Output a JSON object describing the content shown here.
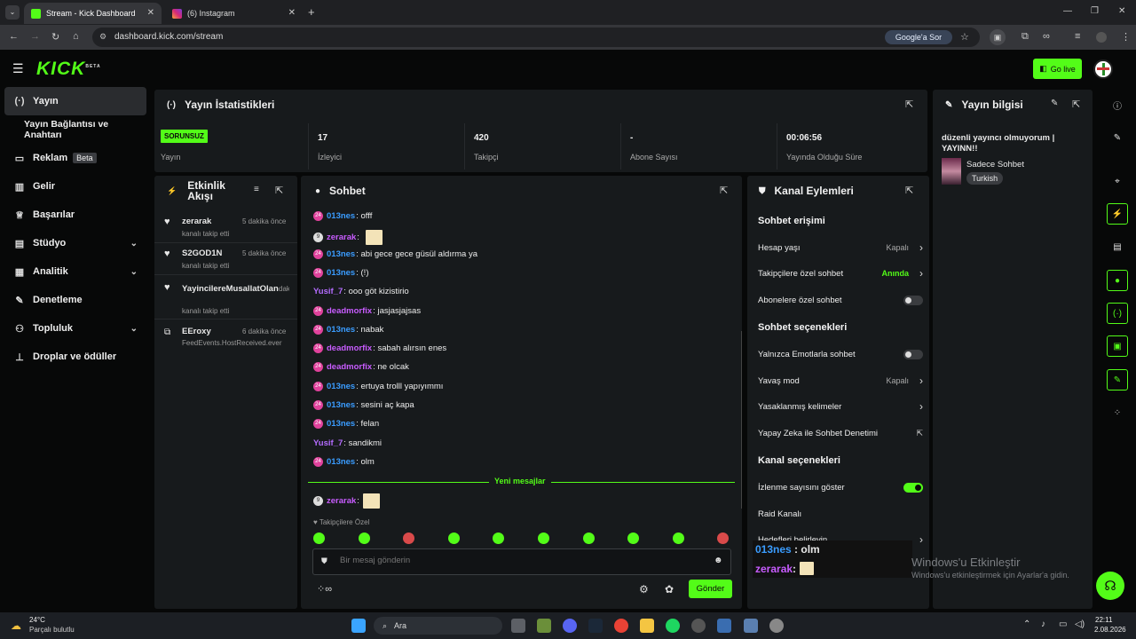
{
  "browser": {
    "tabs": [
      {
        "title": "Stream - Kick Dashboard",
        "active": true
      },
      {
        "title": "(6) Instagram",
        "active": false
      }
    ],
    "url": "dashboard.kick.com/stream",
    "google_button": "Google'a Sor"
  },
  "header": {
    "logo": "KICK",
    "logo_sup": "BETA",
    "go_live": "Go live"
  },
  "sidebar": {
    "items": [
      {
        "label": "Yayın",
        "icon": "broadcast-icon"
      },
      {
        "label": "Yayın Bağlantısı ve Anahtarı",
        "icon": ""
      },
      {
        "label": "Reklam",
        "icon": "ads-icon",
        "badge": "Beta"
      },
      {
        "label": "Gelir",
        "icon": "chart-icon"
      },
      {
        "label": "Başarılar",
        "icon": "trophy-icon"
      },
      {
        "label": "Stüdyo",
        "icon": "studio-icon"
      },
      {
        "label": "Analitik",
        "icon": "analytics-icon"
      },
      {
        "label": "Denetleme",
        "icon": "wrench-icon"
      },
      {
        "label": "Topluluk",
        "icon": "community-icon"
      },
      {
        "label": "Droplar ve ödüller",
        "icon": "drops-icon"
      }
    ]
  },
  "stats": {
    "title": "Yayın İstatistikleri",
    "status_badge": "SORUNSUZ",
    "status_label": "Yayın",
    "cells": [
      {
        "value": "17",
        "label": "İzleyici"
      },
      {
        "value": "420",
        "label": "Takipçi"
      },
      {
        "value": "-",
        "label": "Abone Sayısı"
      },
      {
        "value": "00:06:56",
        "label": "Yayında Olduğu Süre"
      }
    ]
  },
  "activity": {
    "title": "Etkinlik Akışı",
    "items": [
      {
        "user": "zerarak",
        "time": "5 dakika önce",
        "text": "kanalı takip etti",
        "icon": "heart-icon"
      },
      {
        "user": "S2GOD1N",
        "time": "5 dakika önce",
        "text": "kanalı takip etti",
        "icon": "heart-icon"
      },
      {
        "user": "YayincilereMusallatOlan",
        "time": "dakika önce",
        "text": "kanalı takip etti",
        "icon": "heart-icon"
      },
      {
        "user": "EEroxy",
        "time": "6 dakika önce",
        "text": "FeedEvents.HostReceived.ever",
        "icon": "host-icon"
      }
    ]
  },
  "chat": {
    "title": "Sohbet",
    "messages": [
      {
        "user": "013nes",
        "text": "offf",
        "color": "#3a9cff",
        "badge": "pink"
      },
      {
        "user": "zerarak",
        "text": "",
        "color": "#c85cff",
        "badge": "gray",
        "emote": true
      },
      {
        "user": "013nes",
        "text": "abi gece gece güsül aldırma ya",
        "color": "#3a9cff",
        "badge": "pink"
      },
      {
        "user": "013nes",
        "text": "(!)",
        "color": "#3a9cff",
        "badge": "pink"
      },
      {
        "user": "Yusif_7",
        "text": "ooo göt kizistirio",
        "color": "#b46cff",
        "badge": "none"
      },
      {
        "user": "deadmorfix",
        "text": "jasjasjajsas",
        "color": "#c85cff",
        "badge": "pink"
      },
      {
        "user": "013nes",
        "text": "nabak",
        "color": "#3a9cff",
        "badge": "pink"
      },
      {
        "user": "deadmorfix",
        "text": "sabah alırsın enes",
        "color": "#c85cff",
        "badge": "pink"
      },
      {
        "user": "deadmorfix",
        "text": "ne olcak",
        "color": "#c85cff",
        "badge": "pink"
      },
      {
        "user": "013nes",
        "text": "ertuya trolll yapıyımmı",
        "color": "#3a9cff",
        "badge": "pink"
      },
      {
        "user": "013nes",
        "text": "sesini aç kapa",
        "color": "#3a9cff",
        "badge": "pink"
      },
      {
        "user": "013nes",
        "text": "felan",
        "color": "#3a9cff",
        "badge": "pink"
      },
      {
        "user": "Yusif_7",
        "text": "sandikmi",
        "color": "#b46cff",
        "badge": "none"
      },
      {
        "user": "013nes",
        "text": "olm",
        "color": "#3a9cff",
        "badge": "pink"
      }
    ],
    "new_messages": "Yeni mesajlar",
    "last_message": {
      "user": "zerarak",
      "text": "",
      "color": "#c85cff"
    },
    "followers_only": "Takipçilere Özel",
    "input_placeholder": "Bir mesaj gönderin",
    "send": "Gönder"
  },
  "channel_actions": {
    "title": "Kanal Eylemleri",
    "sections": [
      {
        "title": "Sohbet erişimi",
        "rows": [
          {
            "label": "Hesap yaşı",
            "value": "Kapalı",
            "control": "chevron"
          },
          {
            "label": "Takipçilere özel sohbet",
            "value": "Anında",
            "control": "chevron",
            "green": true
          },
          {
            "label": "Abonelere özel sohbet",
            "value": "",
            "control": "toggle-off"
          }
        ]
      },
      {
        "title": "Sohbet seçenekleri",
        "rows": [
          {
            "label": "Yalnızca Emotlarla sohbet",
            "value": "",
            "control": "toggle-off"
          },
          {
            "label": "Yavaş mod",
            "value": "Kapalı",
            "control": "chevron"
          },
          {
            "label": "Yasaklanmış kelimeler",
            "value": "",
            "control": "chevron"
          },
          {
            "label": "Yapay Zeka ile Sohbet Denetimi",
            "value": "",
            "control": "external"
          }
        ]
      },
      {
        "title": "Kanal seçenekleri",
        "rows": [
          {
            "label": "İzlenme sayısını göster",
            "value": "",
            "control": "toggle-on"
          },
          {
            "label": "Raid Kanalı",
            "value": "",
            "control": "none"
          },
          {
            "label": "Hedefleri belirleyin",
            "value": "",
            "control": "chevron"
          }
        ]
      }
    ]
  },
  "stream_info": {
    "title": "Yayın bilgisi",
    "description": "düzenli yayıncı olmuyorum | YAYINN!!",
    "category": "Sadece Sohbet",
    "language": "Turkish"
  },
  "overlay": {
    "line1_user": "013nes",
    "line1_text": "olm",
    "line2_user": "zerarak",
    "activate_title": "Windows'u Etkinleştir",
    "activate_sub": "Windows'u etkinleştirmek için Ayarlar'a gidin."
  },
  "taskbar": {
    "weather_temp": "24°C",
    "weather_desc": "Parçalı bulutlu",
    "search": "Ara",
    "time": "22:11",
    "date": "2.08.2026"
  }
}
